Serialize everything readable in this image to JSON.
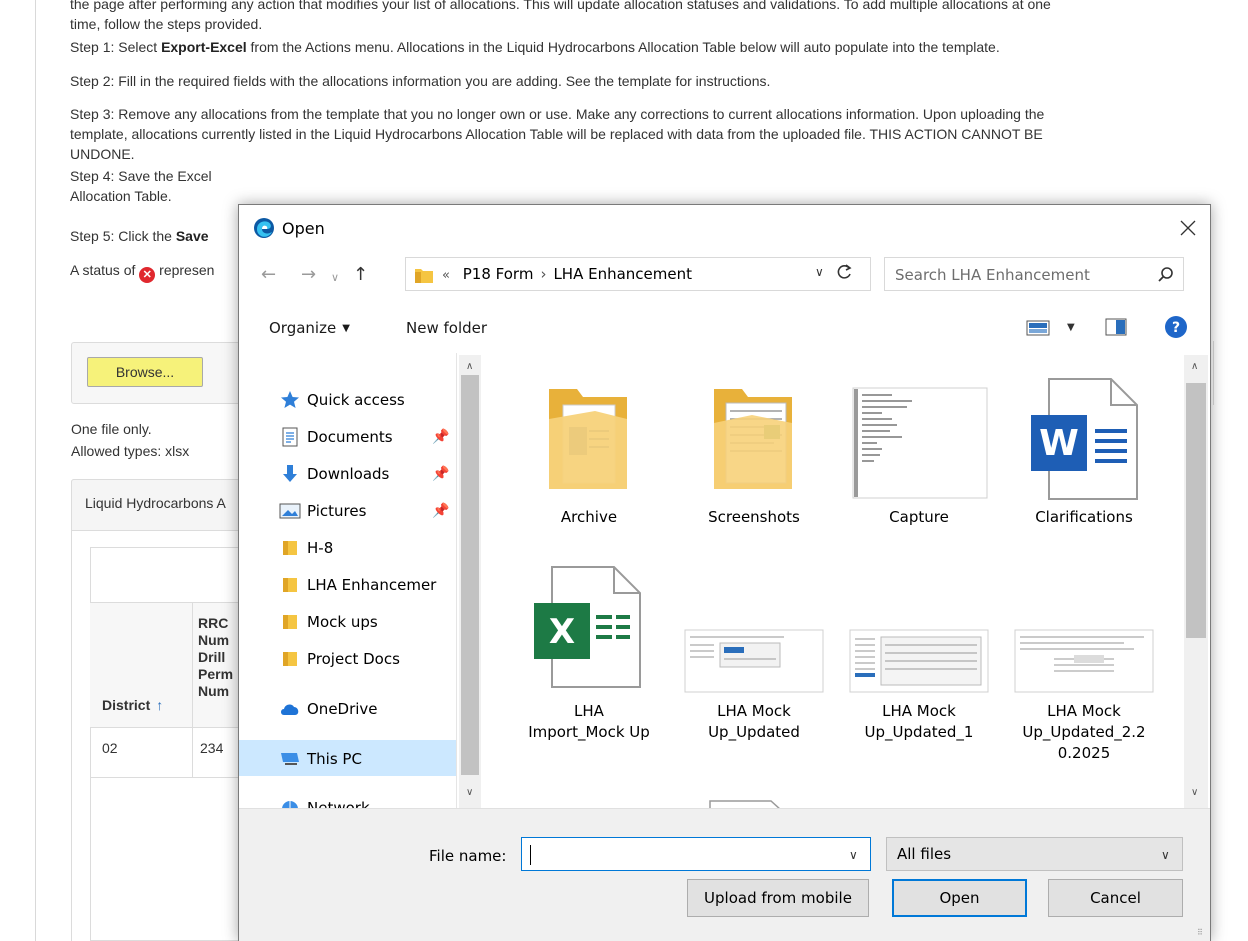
{
  "page": {
    "p0": "the page after performing any action that modifies your list of allocations. This will update allocation statuses and validations. To add multiple allocations at one",
    "p0b": "time, follow the steps provided.",
    "step1_prefix": "Step 1: Select ",
    "step1_bold": "Export-Excel",
    "step1_suffix": " from the Actions menu. Allocations in the Liquid Hydrocarbons Allocation Table below will auto populate into the template.",
    "step2": "Step 2: Fill in the required fields with the allocations information you are adding. See the template for instructions.",
    "step3a": "Step 3: Remove any allocations from the template that you no longer own or use. Make any corrections to current allocations information. Upon uploading the",
    "step3b": "template, allocations currently listed in the Liquid Hydrocarbons Allocation Table will be replaced with data from the uploaded file. THIS ACTION CANNOT BE",
    "step3c": "UNDONE.",
    "step4a": "Step 4: Save the Excel",
    "step4b": "Allocation Table.",
    "step5_prefix": "Step 5: Click the ",
    "step5_bold": "Save",
    "status_prefix": "A status of ",
    "status_suffix": " represen",
    "browse_label": "Browse...",
    "one_file": "One file only.",
    "allowed_types": "Allowed types: xlsx",
    "table_panel_title": "Liquid Hydrocarbons A",
    "col_district": "District",
    "col_rrc": [
      "RRC",
      "Num",
      "Drill",
      "Perm",
      "Num"
    ],
    "row_district": "02",
    "row_rrc": "234",
    "highlight_color": "#f6f27a"
  },
  "dialog": {
    "title": "Open",
    "breadcrumb": [
      "P18 Form",
      "LHA Enhancement"
    ],
    "breadcrumb_overflow": "«",
    "search_placeholder": "Search LHA Enhancement",
    "organize_label": "Organize",
    "new_folder_label": "New folder",
    "nav_items": [
      {
        "label": "Quick access",
        "icon": "star-icon",
        "pinned": false
      },
      {
        "label": "Documents",
        "icon": "documents-icon",
        "pinned": true
      },
      {
        "label": "Downloads",
        "icon": "download-arrow-icon",
        "pinned": true
      },
      {
        "label": "Pictures",
        "icon": "pictures-icon",
        "pinned": true
      },
      {
        "label": "H-8",
        "icon": "folder-icon",
        "pinned": false
      },
      {
        "label": "LHA Enhancemer",
        "icon": "folder-icon",
        "pinned": false
      },
      {
        "label": "Mock ups",
        "icon": "folder-icon",
        "pinned": false
      },
      {
        "label": "Project Docs",
        "icon": "folder-icon",
        "pinned": false
      },
      {
        "label": "OneDrive",
        "icon": "cloud-icon",
        "pinned": false
      },
      {
        "label": "This PC",
        "icon": "computer-icon",
        "pinned": false
      },
      {
        "label": "Network",
        "icon": "network-icon",
        "pinned": false
      }
    ],
    "files": [
      {
        "name": "Archive",
        "kind": "folder-icon"
      },
      {
        "name": "Screenshots",
        "kind": "folder-icon"
      },
      {
        "name": "Capture",
        "kind": "image-thumbnail"
      },
      {
        "name": "Clarifications",
        "kind": "word-doc-icon"
      },
      {
        "name": "LHA Import_Mock Up",
        "kind": "excel-doc-icon"
      },
      {
        "name": "LHA Mock Up_Updated",
        "kind": "image-thumbnail"
      },
      {
        "name": "LHA Mock Up_Updated_1",
        "kind": "image-thumbnail"
      },
      {
        "name": "LHA Mock Up_Updated_2.20.2025",
        "kind": "image-thumbnail"
      }
    ],
    "file_labels": {
      "f4a": "LHA",
      "f4b": "Import_Mock Up",
      "f5a": "LHA Mock",
      "f5b": "Up_Updated",
      "f6a": "LHA Mock",
      "f6b": "Up_Updated_1",
      "f7a": "LHA Mock",
      "f7b": "Up_Updated_2.2",
      "f7c": "0.2025"
    },
    "file_name_label": "File name:",
    "file_name_value": "",
    "file_type_value": "All files",
    "upload_mobile_label": "Upload from mobile",
    "open_label": "Open",
    "cancel_label": "Cancel",
    "accent_color": "#0078d7",
    "selected_bg": "#cce8ff"
  }
}
